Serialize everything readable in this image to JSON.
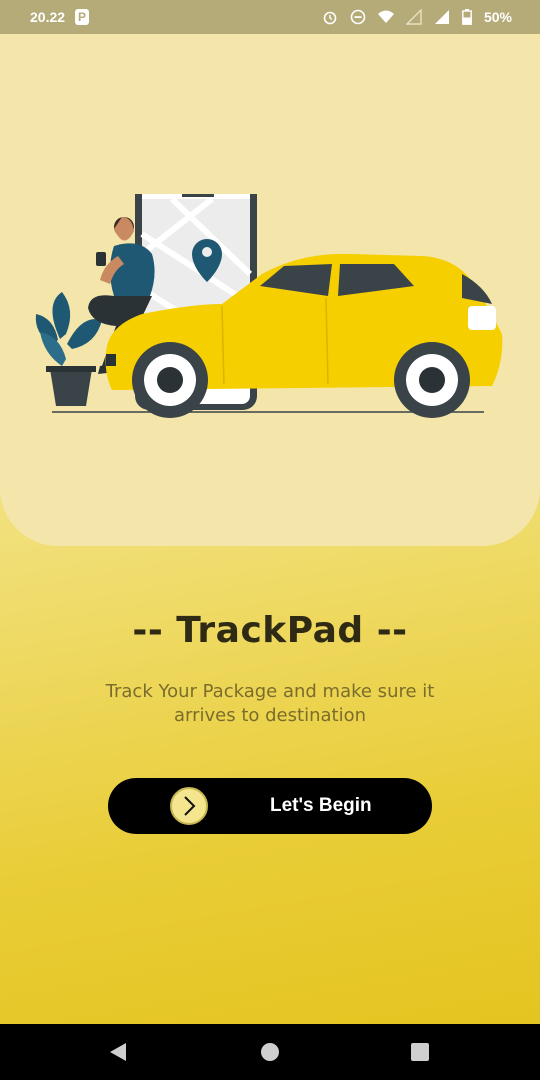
{
  "status_bar": {
    "time": "20.22",
    "app_badge": "P",
    "battery": "50%",
    "icons": [
      "alarm-icon",
      "dnd-icon",
      "wifi-icon",
      "signal-icon",
      "signal-full-icon",
      "battery-icon"
    ]
  },
  "hero": {
    "illustration": "man-with-phone-and-yellow-car",
    "colors": {
      "car": "#f6cf00",
      "phone": "#3a4448",
      "pin": "#1f5873",
      "plant": "#1f5873"
    }
  },
  "title": "-- TrackPad --",
  "subtitle": "Track Your Package and make sure it arrives to destination",
  "begin_button": {
    "label": "Let's Begin",
    "icon": "chevron-right-icon"
  },
  "nav": {
    "back": "back-icon",
    "home": "home-icon",
    "recents": "recents-icon"
  },
  "colors": {
    "accent": "#000000",
    "background": "#f1e07a",
    "title": "#2e2a14",
    "subtitle": "#7a6d2c"
  }
}
